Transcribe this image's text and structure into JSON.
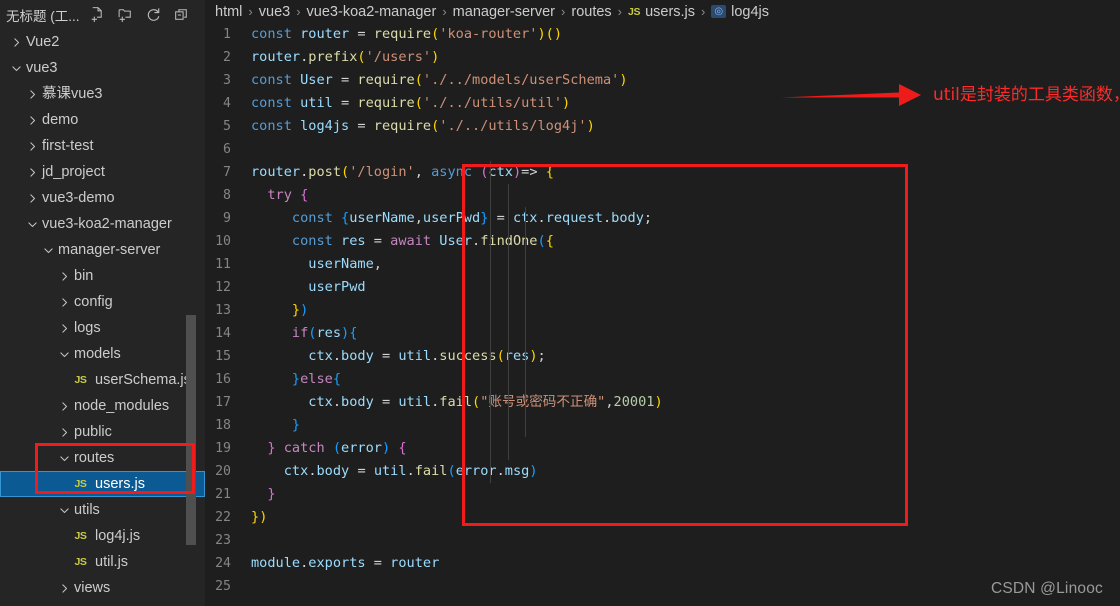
{
  "sidebar": {
    "title": "无标题 (工...",
    "actions": [
      {
        "name": "new-file-icon",
        "label": "New File"
      },
      {
        "name": "new-folder-icon",
        "label": "New Folder"
      },
      {
        "name": "refresh-explorer-icon",
        "label": "Refresh Explorer"
      },
      {
        "name": "collapse-folders-icon",
        "label": "Collapse Folders in Explorer"
      }
    ],
    "tree": [
      {
        "label": "Vue2",
        "depth": 0,
        "type": "folder",
        "state": "collapsed",
        "selected": false
      },
      {
        "label": "vue3",
        "depth": 0,
        "type": "folder",
        "state": "expanded",
        "selected": false
      },
      {
        "label": "慕课vue3",
        "depth": 1,
        "type": "folder",
        "state": "collapsed",
        "selected": false
      },
      {
        "label": "demo",
        "depth": 1,
        "type": "folder",
        "state": "collapsed",
        "selected": false
      },
      {
        "label": "first-test",
        "depth": 1,
        "type": "folder",
        "state": "collapsed",
        "selected": false
      },
      {
        "label": "jd_project",
        "depth": 1,
        "type": "folder",
        "state": "collapsed",
        "selected": false
      },
      {
        "label": "vue3-demo",
        "depth": 1,
        "type": "folder",
        "state": "collapsed",
        "selected": false
      },
      {
        "label": "vue3-koa2-manager",
        "depth": 1,
        "type": "folder",
        "state": "expanded",
        "selected": false
      },
      {
        "label": "manager-server",
        "depth": 2,
        "type": "folder",
        "state": "expanded",
        "selected": false
      },
      {
        "label": "bin",
        "depth": 3,
        "type": "folder",
        "state": "collapsed",
        "selected": false
      },
      {
        "label": "config",
        "depth": 3,
        "type": "folder",
        "state": "collapsed",
        "selected": false
      },
      {
        "label": "logs",
        "depth": 3,
        "type": "folder",
        "state": "collapsed",
        "selected": false
      },
      {
        "label": "models",
        "depth": 3,
        "type": "folder",
        "state": "expanded",
        "selected": false
      },
      {
        "label": "userSchema.js",
        "depth": 4,
        "type": "js",
        "state": "file",
        "selected": false
      },
      {
        "label": "node_modules",
        "depth": 3,
        "type": "folder",
        "state": "collapsed",
        "selected": false
      },
      {
        "label": "public",
        "depth": 3,
        "type": "folder",
        "state": "collapsed",
        "selected": false
      },
      {
        "label": "routes",
        "depth": 3,
        "type": "folder",
        "state": "expanded",
        "selected": false
      },
      {
        "label": "users.js",
        "depth": 4,
        "type": "js",
        "state": "file",
        "selected": true
      },
      {
        "label": "utils",
        "depth": 3,
        "type": "folder",
        "state": "expanded",
        "selected": false
      },
      {
        "label": "log4j.js",
        "depth": 4,
        "type": "js",
        "state": "file",
        "selected": false
      },
      {
        "label": "util.js",
        "depth": 4,
        "type": "js",
        "state": "file",
        "selected": false
      },
      {
        "label": "views",
        "depth": 3,
        "type": "folder",
        "state": "collapsed",
        "selected": false
      }
    ]
  },
  "breadcrumb": [
    {
      "label": "html",
      "icon": "none"
    },
    {
      "label": "vue3",
      "icon": "none"
    },
    {
      "label": "vue3-koa2-manager",
      "icon": "none"
    },
    {
      "label": "manager-server",
      "icon": "none"
    },
    {
      "label": "routes",
      "icon": "none"
    },
    {
      "label": "users.js",
      "icon": "js-file-icon"
    },
    {
      "label": "log4js",
      "icon": "symbol-variable-icon"
    }
  ],
  "editor": {
    "language": "javascript",
    "first_line": 1,
    "last_line": 25,
    "lines": [
      {
        "n": 1,
        "tokens": [
          [
            "t-kw",
            "const"
          ],
          [
            "t-plain",
            " "
          ],
          [
            "t-var",
            "router"
          ],
          [
            "t-plain",
            " "
          ],
          [
            "t-pun",
            "="
          ],
          [
            "t-plain",
            " "
          ],
          [
            "t-fn",
            "require"
          ],
          [
            "t-br1",
            "("
          ],
          [
            "t-str",
            "'koa-router'"
          ],
          [
            "t-br1",
            ")"
          ],
          [
            "t-br1",
            "("
          ],
          [
            "t-br1",
            ")"
          ]
        ]
      },
      {
        "n": 2,
        "tokens": [
          [
            "t-var",
            "router"
          ],
          [
            "t-pun",
            "."
          ],
          [
            "t-fn",
            "prefix"
          ],
          [
            "t-br1",
            "("
          ],
          [
            "t-str",
            "'/users'"
          ],
          [
            "t-br1",
            ")"
          ]
        ]
      },
      {
        "n": 3,
        "tokens": [
          [
            "t-kw",
            "const"
          ],
          [
            "t-plain",
            " "
          ],
          [
            "t-var",
            "User"
          ],
          [
            "t-plain",
            " "
          ],
          [
            "t-pun",
            "="
          ],
          [
            "t-plain",
            " "
          ],
          [
            "t-fn",
            "require"
          ],
          [
            "t-br1",
            "("
          ],
          [
            "t-str",
            "'./../models/userSchema'"
          ],
          [
            "t-br1",
            ")"
          ]
        ]
      },
      {
        "n": 4,
        "tokens": [
          [
            "t-kw",
            "const"
          ],
          [
            "t-plain",
            " "
          ],
          [
            "t-var",
            "util"
          ],
          [
            "t-plain",
            " "
          ],
          [
            "t-pun",
            "="
          ],
          [
            "t-plain",
            " "
          ],
          [
            "t-fn",
            "require"
          ],
          [
            "t-br1",
            "("
          ],
          [
            "t-str",
            "'./../utils/util'"
          ],
          [
            "t-br1",
            ")"
          ]
        ]
      },
      {
        "n": 5,
        "tokens": [
          [
            "t-kw",
            "const"
          ],
          [
            "t-plain",
            " "
          ],
          [
            "t-var",
            "log4js"
          ],
          [
            "t-plain",
            " "
          ],
          [
            "t-pun",
            "="
          ],
          [
            "t-plain",
            " "
          ],
          [
            "t-fn",
            "require"
          ],
          [
            "t-br1",
            "("
          ],
          [
            "t-str",
            "'./../utils/log4j'"
          ],
          [
            "t-br1",
            ")"
          ]
        ]
      },
      {
        "n": 6,
        "tokens": []
      },
      {
        "n": 7,
        "tokens": [
          [
            "t-var",
            "router"
          ],
          [
            "t-pun",
            "."
          ],
          [
            "t-fn",
            "post"
          ],
          [
            "t-br1",
            "("
          ],
          [
            "t-str",
            "'/login'"
          ],
          [
            "t-pun",
            ", "
          ],
          [
            "t-kw",
            "async"
          ],
          [
            "t-plain",
            " "
          ],
          [
            "t-br2",
            "("
          ],
          [
            "t-var",
            "ctx"
          ],
          [
            "t-br2",
            ")"
          ],
          [
            "t-pun",
            "=> "
          ],
          [
            "t-br1",
            "{"
          ]
        ]
      },
      {
        "n": 8,
        "tokens": [
          [
            "t-plain",
            "  "
          ],
          [
            "t-ctl",
            "try"
          ],
          [
            "t-plain",
            " "
          ],
          [
            "t-br2",
            "{"
          ]
        ]
      },
      {
        "n": 9,
        "tokens": [
          [
            "t-plain",
            "     "
          ],
          [
            "t-kw",
            "const"
          ],
          [
            "t-plain",
            " "
          ],
          [
            "t-br3",
            "{"
          ],
          [
            "t-var",
            "userName"
          ],
          [
            "t-pun",
            ","
          ],
          [
            "t-var",
            "userPwd"
          ],
          [
            "t-br3",
            "}"
          ],
          [
            "t-plain",
            " "
          ],
          [
            "t-pun",
            "="
          ],
          [
            "t-plain",
            " "
          ],
          [
            "t-var",
            "ctx"
          ],
          [
            "t-pun",
            "."
          ],
          [
            "t-var",
            "request"
          ],
          [
            "t-pun",
            "."
          ],
          [
            "t-var",
            "body"
          ],
          [
            "t-pun",
            ";"
          ]
        ]
      },
      {
        "n": 10,
        "tokens": [
          [
            "t-plain",
            "     "
          ],
          [
            "t-kw",
            "const"
          ],
          [
            "t-plain",
            " "
          ],
          [
            "t-var",
            "res"
          ],
          [
            "t-plain",
            " "
          ],
          [
            "t-pun",
            "="
          ],
          [
            "t-plain",
            " "
          ],
          [
            "t-ctl",
            "await"
          ],
          [
            "t-plain",
            " "
          ],
          [
            "t-var",
            "User"
          ],
          [
            "t-pun",
            "."
          ],
          [
            "t-fn",
            "findOne"
          ],
          [
            "t-br3",
            "("
          ],
          [
            "t-br1",
            "{"
          ]
        ]
      },
      {
        "n": 11,
        "tokens": [
          [
            "t-plain",
            "       "
          ],
          [
            "t-var",
            "userName"
          ],
          [
            "t-pun",
            ","
          ]
        ]
      },
      {
        "n": 12,
        "tokens": [
          [
            "t-plain",
            "       "
          ],
          [
            "t-var",
            "userPwd"
          ]
        ]
      },
      {
        "n": 13,
        "tokens": [
          [
            "t-plain",
            "     "
          ],
          [
            "t-br1",
            "}"
          ],
          [
            "t-br3",
            ")"
          ]
        ]
      },
      {
        "n": 14,
        "tokens": [
          [
            "t-plain",
            "     "
          ],
          [
            "t-ctl",
            "if"
          ],
          [
            "t-br3",
            "("
          ],
          [
            "t-var",
            "res"
          ],
          [
            "t-br3",
            ")"
          ],
          [
            "t-br3",
            "{"
          ]
        ]
      },
      {
        "n": 15,
        "tokens": [
          [
            "t-plain",
            "       "
          ],
          [
            "t-var",
            "ctx"
          ],
          [
            "t-pun",
            "."
          ],
          [
            "t-var",
            "body"
          ],
          [
            "t-plain",
            " "
          ],
          [
            "t-pun",
            "="
          ],
          [
            "t-plain",
            " "
          ],
          [
            "t-var",
            "util"
          ],
          [
            "t-pun",
            "."
          ],
          [
            "t-fn",
            "success"
          ],
          [
            "t-br1",
            "("
          ],
          [
            "t-var",
            "res"
          ],
          [
            "t-br1",
            ")"
          ],
          [
            "t-pun",
            ";"
          ]
        ]
      },
      {
        "n": 16,
        "tokens": [
          [
            "t-plain",
            "     "
          ],
          [
            "t-br3",
            "}"
          ],
          [
            "t-ctl",
            "else"
          ],
          [
            "t-br3",
            "{"
          ]
        ]
      },
      {
        "n": 17,
        "tokens": [
          [
            "t-plain",
            "       "
          ],
          [
            "t-var",
            "ctx"
          ],
          [
            "t-pun",
            "."
          ],
          [
            "t-var",
            "body"
          ],
          [
            "t-plain",
            " "
          ],
          [
            "t-pun",
            "="
          ],
          [
            "t-plain",
            " "
          ],
          [
            "t-var",
            "util"
          ],
          [
            "t-pun",
            "."
          ],
          [
            "t-fn",
            "fail"
          ],
          [
            "t-br1",
            "("
          ],
          [
            "t-str",
            "\"账号或密码不正确\""
          ],
          [
            "t-pun",
            ","
          ],
          [
            "t-num",
            "20001"
          ],
          [
            "t-br1",
            ")"
          ]
        ]
      },
      {
        "n": 18,
        "tokens": [
          [
            "t-plain",
            "     "
          ],
          [
            "t-br3",
            "}"
          ]
        ]
      },
      {
        "n": 19,
        "tokens": [
          [
            "t-plain",
            "  "
          ],
          [
            "t-br2",
            "}"
          ],
          [
            "t-plain",
            " "
          ],
          [
            "t-ctl",
            "catch"
          ],
          [
            "t-plain",
            " "
          ],
          [
            "t-br3",
            "("
          ],
          [
            "t-var",
            "error"
          ],
          [
            "t-br3",
            ")"
          ],
          [
            "t-plain",
            " "
          ],
          [
            "t-br2",
            "{"
          ]
        ]
      },
      {
        "n": 20,
        "tokens": [
          [
            "t-plain",
            "    "
          ],
          [
            "t-var",
            "ctx"
          ],
          [
            "t-pun",
            "."
          ],
          [
            "t-var",
            "body"
          ],
          [
            "t-plain",
            " "
          ],
          [
            "t-pun",
            "="
          ],
          [
            "t-plain",
            " "
          ],
          [
            "t-var",
            "util"
          ],
          [
            "t-pun",
            "."
          ],
          [
            "t-fn",
            "fail"
          ],
          [
            "t-br3",
            "("
          ],
          [
            "t-var",
            "error"
          ],
          [
            "t-pun",
            "."
          ],
          [
            "t-var",
            "msg"
          ],
          [
            "t-br3",
            ")"
          ]
        ]
      },
      {
        "n": 21,
        "tokens": [
          [
            "t-plain",
            "  "
          ],
          [
            "t-br2",
            "}"
          ]
        ]
      },
      {
        "n": 22,
        "tokens": [
          [
            "t-br1",
            "}"
          ],
          [
            "t-br1",
            ")"
          ]
        ]
      },
      {
        "n": 23,
        "tokens": []
      },
      {
        "n": 24,
        "tokens": [
          [
            "t-var",
            "module"
          ],
          [
            "t-pun",
            "."
          ],
          [
            "t-var",
            "exports"
          ],
          [
            "t-plain",
            " "
          ],
          [
            "t-pun",
            "="
          ],
          [
            "t-plain",
            " "
          ],
          [
            "t-var",
            "router"
          ]
        ]
      },
      {
        "n": 25,
        "tokens": []
      }
    ]
  },
  "annotation": {
    "text": "util是封装的工具类函数，下面贴出图片",
    "color": "#ff2a2a",
    "arrow": "right-arrow-icon"
  },
  "watermark": "CSDN @Linooc",
  "colors": {
    "editor_bg": "#1e1e1e",
    "sidebar_bg": "#252526",
    "selection_blue": "#0c5a94",
    "annotation_red": "#f21b1b",
    "js_icon_yellow": "#cbcb41"
  }
}
